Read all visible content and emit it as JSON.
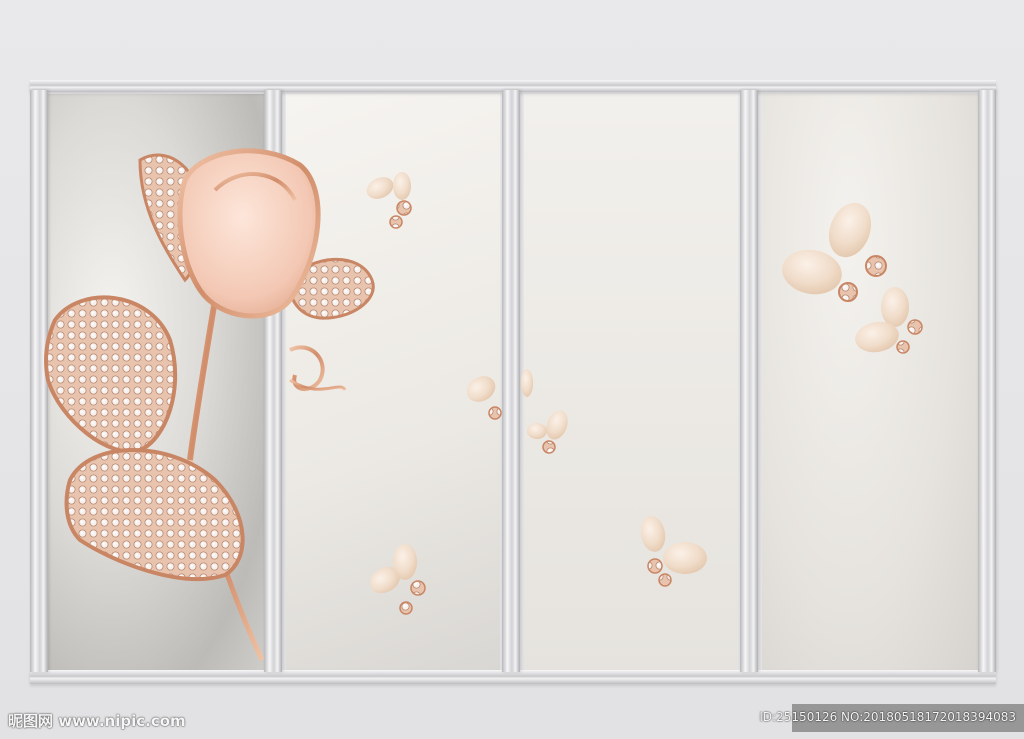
{
  "watermark": {
    "site": "昵图网 www.nipic.com",
    "id_text": "ID:25150126 NO:20180518172018394083"
  },
  "colors": {
    "rose_gold": "#d99b7a",
    "pearl": "#f3e4d6",
    "silk": "#e9e6e1",
    "frame_silver": "#d8d8dc"
  }
}
